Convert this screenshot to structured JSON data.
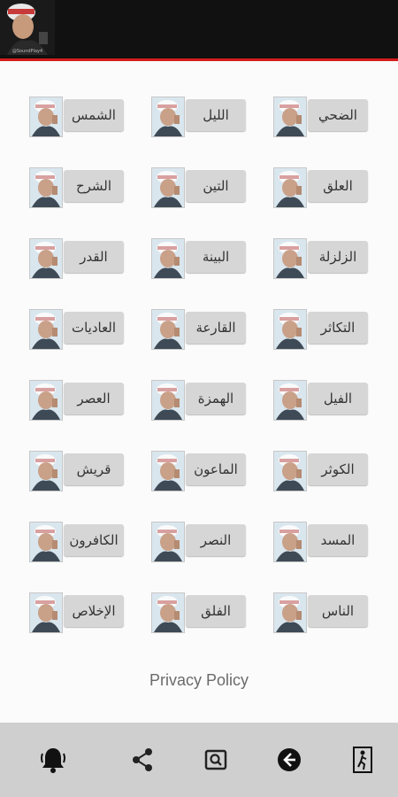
{
  "header": {
    "avatar_caption": "@SoundPlay4"
  },
  "surahs": [
    "الضحي",
    "الليل",
    "الشمس",
    "العلق",
    "التين",
    "الشرح",
    "الزلزلة",
    "البينة",
    "القدر",
    "التكاثر",
    "القارعة",
    "العاديات",
    "الفيل",
    "الهمزة",
    "العصر",
    "الكوثر",
    "الماعون",
    "قريش",
    "المسد",
    "النصر",
    "الكافرون",
    "الناس",
    "الفلق",
    "الإخلاص"
  ],
  "footer": {
    "privacy_label": "Privacy Policy"
  },
  "bottom_bar": {
    "icons": [
      "bell-icon",
      "share-icon",
      "search-icon",
      "back-icon",
      "exit-icon"
    ]
  },
  "colors": {
    "accent": "#d61b1b",
    "topbar": "#111111",
    "label_bg": "#d6d6d6",
    "bottom_bar": "#cfcfcf"
  }
}
